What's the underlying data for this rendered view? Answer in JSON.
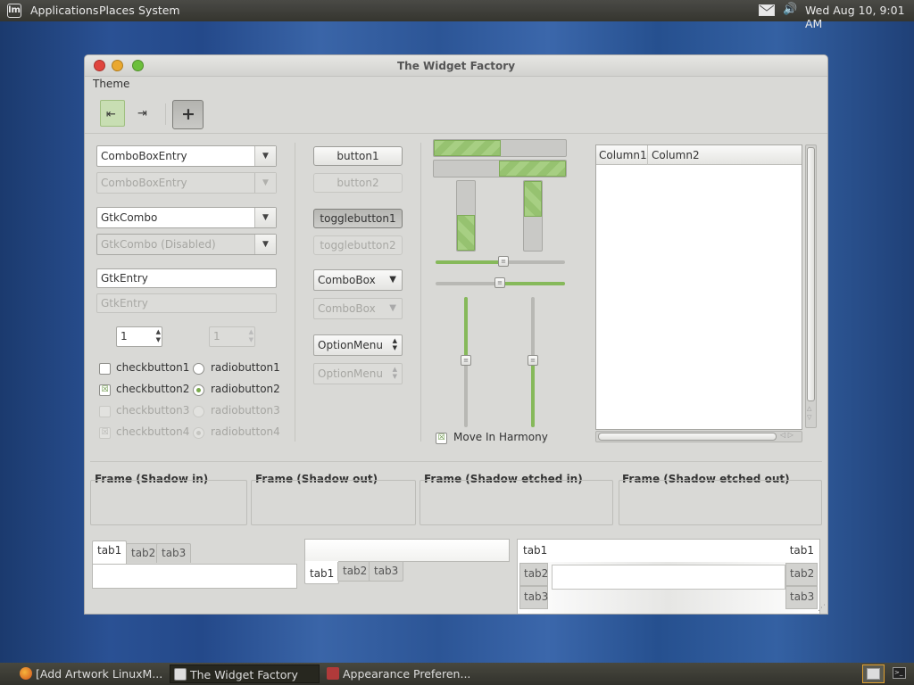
{
  "top_panel": {
    "menus": [
      "Applications",
      "Places",
      "System"
    ],
    "clock": "Wed Aug 10,  9:01 AM"
  },
  "window": {
    "title": "The Widget Factory",
    "menu_theme": "Theme",
    "left_col": {
      "combobox_entry": "ComboBoxEntry",
      "combobox_entry_disabled": "ComboBoxEntry",
      "gtkcombo": "GtkCombo",
      "gtkcombo_disabled": "GtkCombo (Disabled)",
      "gtkentry": "GtkEntry",
      "gtkentry_placeholder": "GtkEntry",
      "spin1": "1",
      "spin2": "1",
      "checks": [
        "checkbutton1",
        "checkbutton2",
        "checkbutton3",
        "checkbutton4"
      ],
      "radios": [
        "radiobutton1",
        "radiobutton2",
        "radiobutton3",
        "radiobutton4"
      ]
    },
    "mid_col": {
      "button1": "button1",
      "button2": "button2",
      "toggle1": "togglebutton1",
      "toggle2": "togglebutton2",
      "combobox1": "ComboBox",
      "combobox2": "ComboBox",
      "optionmenu1": "OptionMenu",
      "optionmenu2": "OptionMenu"
    },
    "progress": {
      "h1": 0.5,
      "h2": 0.5,
      "v1": 0.5,
      "v2": 0.5,
      "hscale1": 0.52,
      "hscale2": 0.5,
      "vscale1": 0.5,
      "vscale2": 0.5
    },
    "move_in_harmony": "Move In Harmony",
    "tree": {
      "columns": [
        "Column1",
        "Column2"
      ]
    },
    "frames": [
      "Frame (Shadow in)",
      "Frame (Shadow out)",
      "Frame (Shadow etched in)",
      "Frame (Shadow etched out)"
    ],
    "notebooks": {
      "nb1_tabs": [
        "tab1",
        "tab2",
        "tab3"
      ],
      "nb2_tabs": [
        "tab1",
        "tab2",
        "tab3"
      ],
      "nb3_left": [
        "tab1",
        "tab2",
        "tab3"
      ],
      "nb3_right": [
        "tab1",
        "tab2",
        "tab3"
      ]
    }
  },
  "taskbar": {
    "tasks": [
      "[Add  Artwork LinuxM...",
      "The Widget Factory",
      "Appearance Preferen..."
    ]
  }
}
